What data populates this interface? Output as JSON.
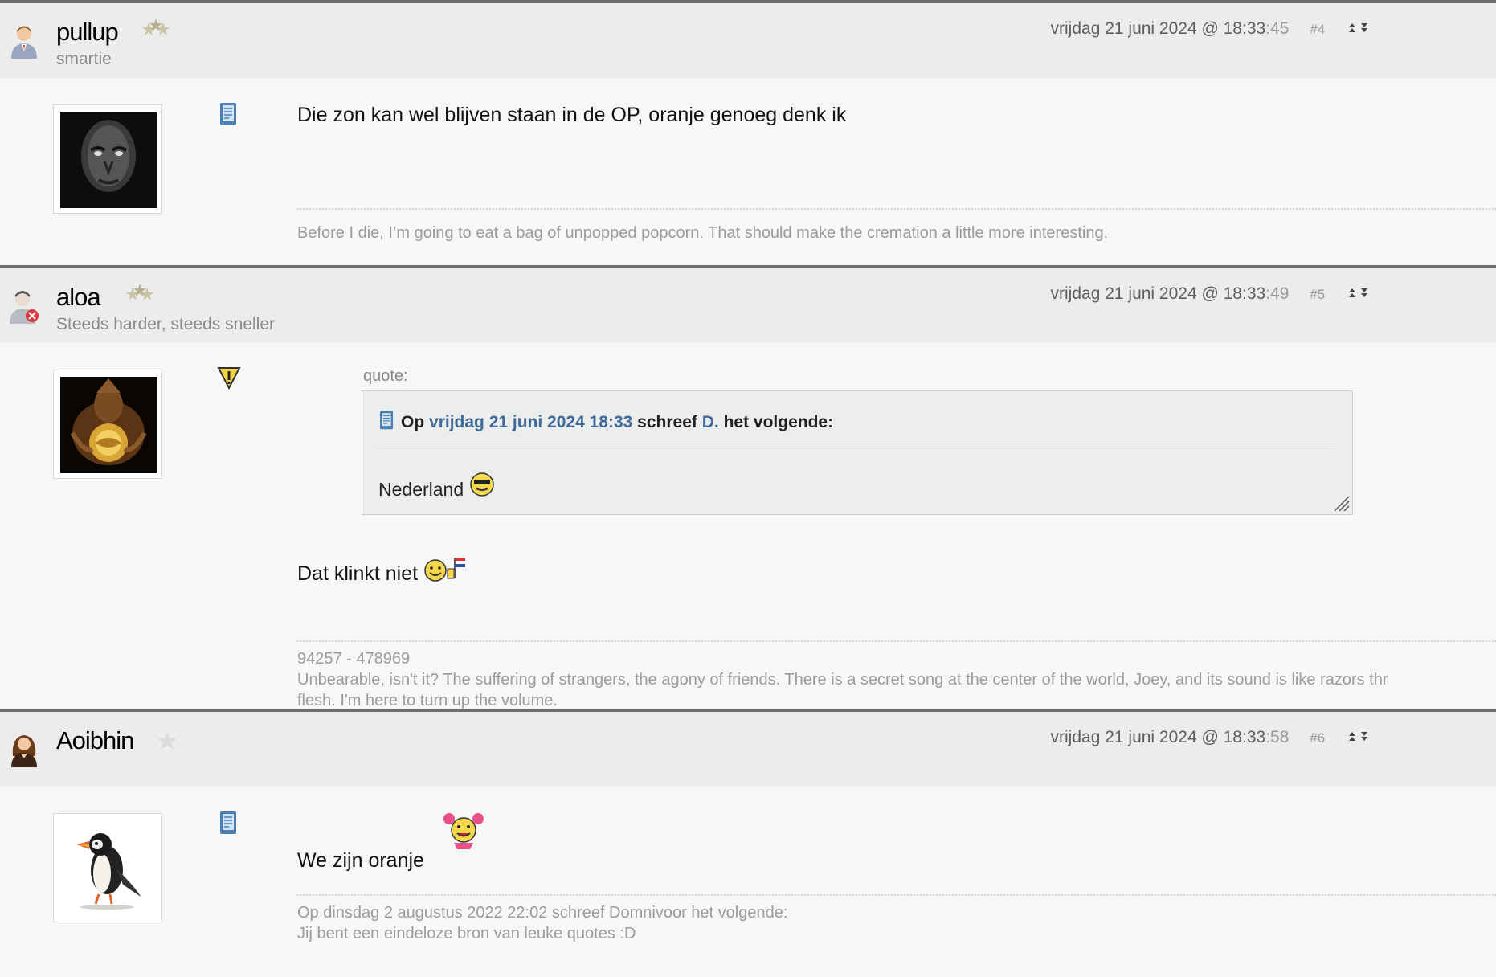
{
  "posts": [
    {
      "username": "pullup",
      "user_title": "smartie",
      "date": "vrijdag 21 juni 2024 @ 18:33",
      "seconds": ":45",
      "number": "#4",
      "message": "Die zon kan wel blijven staan in de OP, oranje genoeg denk ik",
      "signature": [
        "Before I die, I’m going to eat a bag of unpopped popcorn. That should make the cremation a little more interesting."
      ],
      "user_icon": "user-male-icon",
      "device_icon": "mobile-device-icon",
      "rank_icon": "rank-stars-icon"
    },
    {
      "username": "aloa",
      "user_title": "Steeds harder, steeds sneller",
      "date": "vrijdag 21 juni 2024 @ 18:33",
      "seconds": ":49",
      "number": "#5",
      "quote": {
        "label": "quote:",
        "prefix": "Op",
        "date_link": "vrijdag 21 juni 2024 18:33",
        "wrote": "schreef",
        "author_link": "D.",
        "suffix": "het volgende:",
        "text": "Nederland"
      },
      "message": "Dat klinkt niet",
      "signature": [
        "94257 - 478969",
        "Unbearable, isn't it? The suffering of strangers, the agony of friends. There is a secret song at the center of the world, Joey, and its sound is like razors thr",
        "flesh. I'm here to turn up the volume."
      ],
      "user_icon": "user-blocked-icon",
      "device_icon": "warning-triangle-icon",
      "rank_icon": "rank-stars-icon"
    },
    {
      "username": "Aoibhin",
      "user_title": "",
      "date": "vrijdag 21 juni 2024 @ 18:33",
      "seconds": ":58",
      "number": "#6",
      "message": "We zijn oranje",
      "signature": [
        "Op dinsdag 2 augustus 2022 22:02 schreef Domnivoor het volgende:",
        "Jij bent een eindeloze bron van leuke quotes :D"
      ],
      "user_icon": "user-female-icon",
      "device_icon": "mobile-device-icon",
      "rank_icon": "rank-star-icon"
    }
  ],
  "colors": {
    "background": "#f7f7f7",
    "header_background": "#ececec",
    "separator": "#6d6d6d",
    "link": "#3e6a9a",
    "muted_text": "#8a8a8a"
  }
}
